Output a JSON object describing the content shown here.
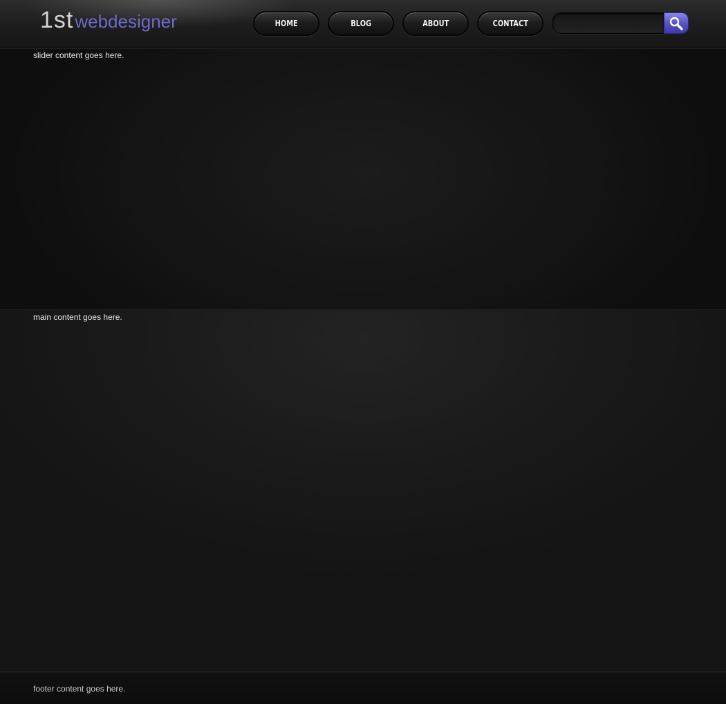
{
  "header": {
    "logo": {
      "prefix": "1st",
      "word": "webdesigner"
    },
    "nav": [
      {
        "label": "HOME"
      },
      {
        "label": "BLOG"
      },
      {
        "label": "ABOUT"
      },
      {
        "label": "CONTACT"
      }
    ],
    "search": {
      "value": "",
      "placeholder": "",
      "icon": "search-icon"
    }
  },
  "slider": {
    "text": "slider content goes here."
  },
  "main": {
    "text": "main content goes here."
  },
  "footer": {
    "text": "footer content goes here."
  },
  "colors": {
    "accent": "#6d6ac8",
    "search_button": "#5753c4",
    "background": "#151515"
  }
}
